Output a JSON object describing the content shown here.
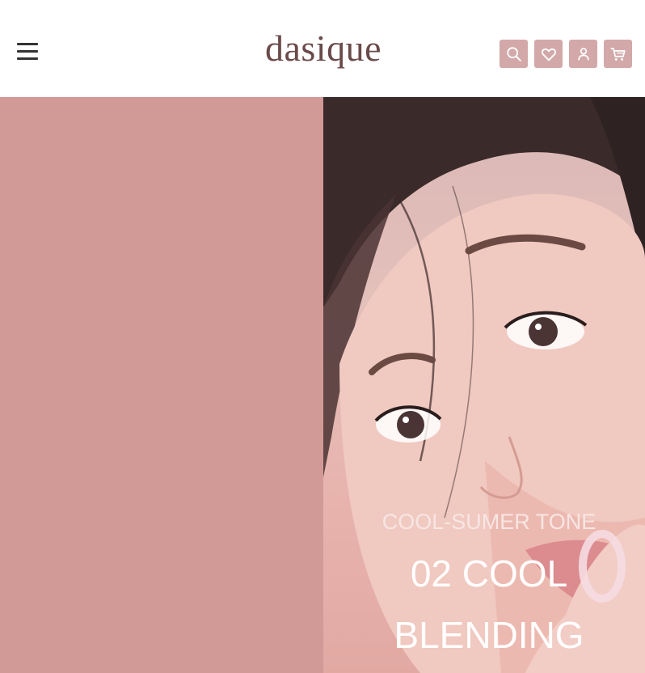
{
  "header": {
    "logo": "dasique",
    "menu_icon": "hamburger-menu-icon",
    "icon_bg_color": "#d3a8a9",
    "icons": [
      "search-icon",
      "heart-icon",
      "user-icon",
      "cart-icon"
    ]
  },
  "hero": {
    "left_panel_color": "#d19a96",
    "subtitle": "COOL-SUMER TONE",
    "title_line1": "02 COOL",
    "title_line2": "BLENDING"
  }
}
